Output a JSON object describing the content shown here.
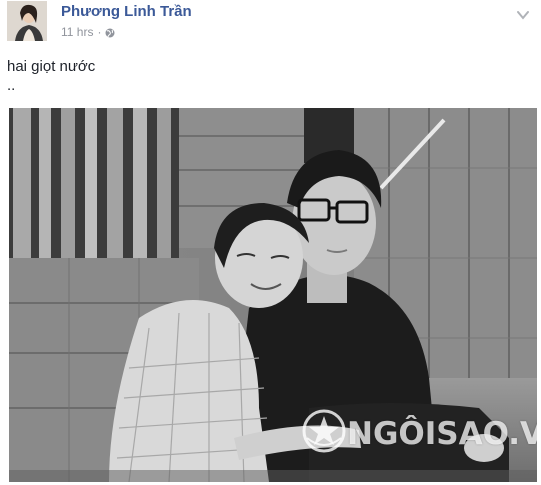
{
  "post": {
    "author_name": "Phương Linh Trần",
    "timestamp": "11 hrs",
    "separator": "·",
    "privacy_icon": "globe-icon",
    "menu_icon": "chevron-down-icon",
    "text_lines": [
      "hai giọt nước",
      ".."
    ]
  },
  "photo": {
    "watermark": "NGÔISAO.VN",
    "watermark_logo_icon": "star-badge-icon"
  },
  "colors": {
    "author": "#3b5998",
    "meta": "#90949c",
    "text": "#1d2129"
  }
}
